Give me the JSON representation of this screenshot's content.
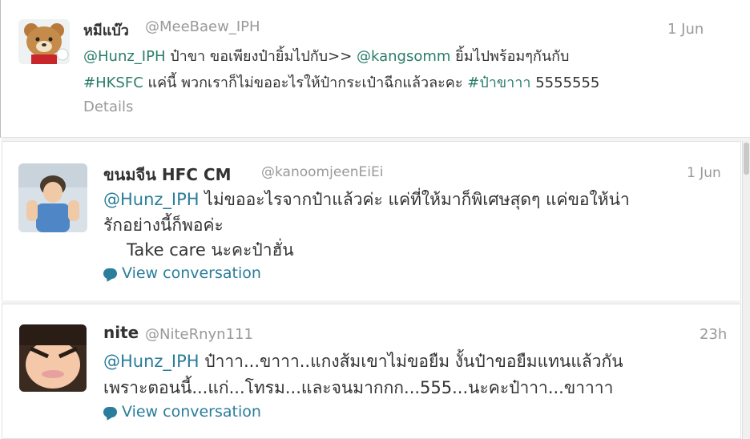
{
  "tweets": [
    {
      "name": "หมีแบ๊ว",
      "handle": "@MeeBaew_IPH",
      "time": "1 Jun",
      "line1": {
        "mention1": "@Hunz_IPH",
        "text1": " ป๋าขา ขอเพียงป๋ายิ้มไปกับ>> ",
        "mention2": "@kangsomm",
        "text2": " ยิ้มไปพร้อมๆกันกับ"
      },
      "line2": {
        "hashtag1": "#HKSFC",
        "text1": " แค่นี้ พวกเราก็ไม่ขออะไรให้ป๋ากระเป๋าฉีกแล้วละคะ ",
        "hashtag2": "#ป๋าขาาา",
        "text2": " 5555555"
      },
      "details": "Details",
      "avatar_icon": "bear-avatar-icon"
    },
    {
      "name": "ขนมจีน HFC CM",
      "handle": "@kanoomjeenEiEi",
      "time": "1 Jun",
      "line1": {
        "mention": "@Hunz_IPH",
        "text": " ไม่ขออะไรจากป๋าแล้วค่ะ แค่ที่ให้มาก็พิเศษสุดๆ  แค่ขอให้น่า"
      },
      "line2": "รักอย่างนี้ก็พอค่ะ",
      "line3": "Take care นะคะป๋าฮั่น",
      "view": "View conversation",
      "avatar_icon": "girl-avatar-icon"
    },
    {
      "name": "nite",
      "handle": "@NiteRnyn111",
      "time": "23h",
      "line1": {
        "mention": "@Hunz_IPH",
        "text": " ป๋าาา...ขาาา..แกงส้มเขาไม่ขอยืม งั้นป๋าขอยืมแทนแล้วกัน"
      },
      "line2": "เพราะตอนนี้...แก่...โทรม...และจนมากกก...555...นะคะป๋าาา...ขาาาา",
      "view": "View conversation",
      "avatar_icon": "face-avatar-icon"
    }
  ],
  "colors": {
    "link": "#2a7d9b",
    "mention": "#2a7d6b",
    "muted": "#999999",
    "text": "#333333"
  }
}
